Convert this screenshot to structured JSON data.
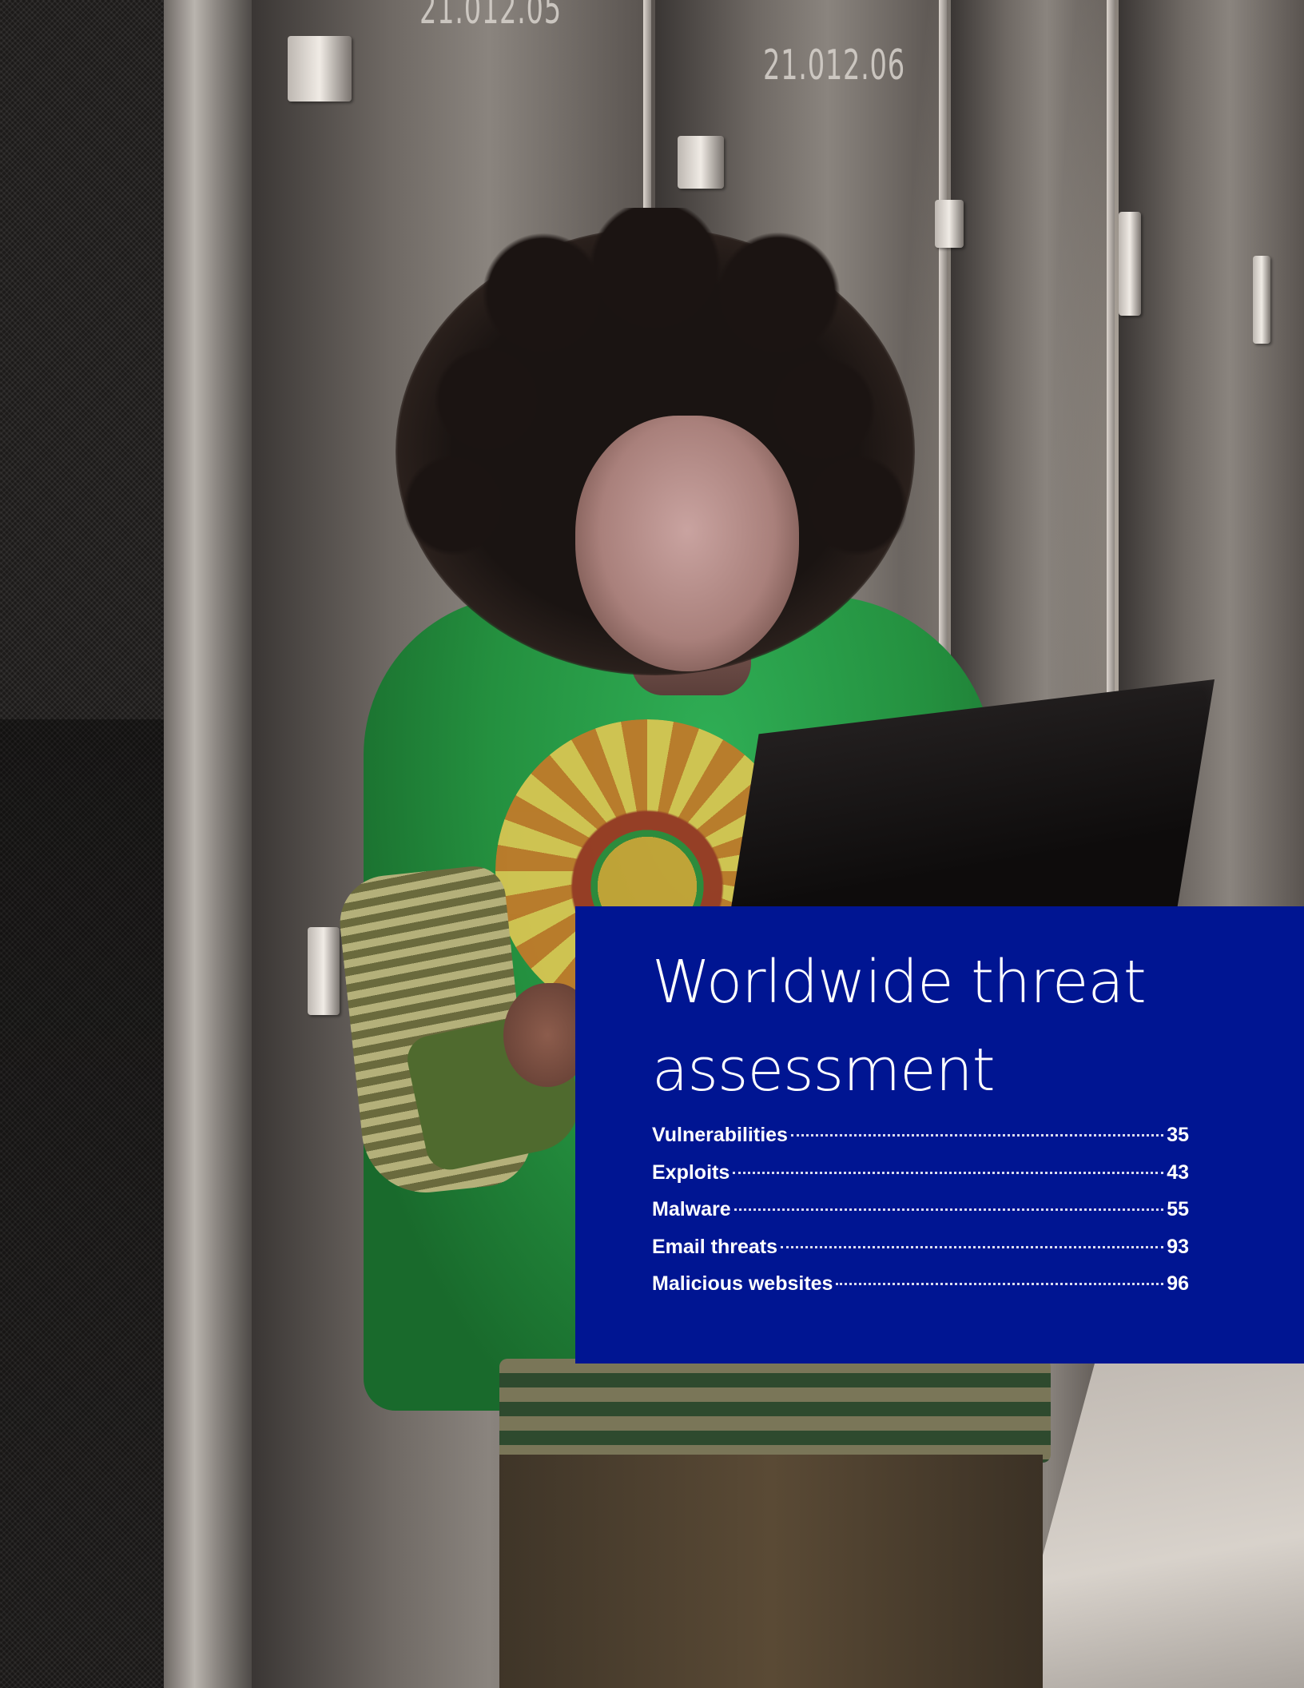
{
  "background_photo": {
    "rack_numbers": [
      "21.012.05",
      "21.012.06"
    ]
  },
  "panel": {
    "title": "Worldwide threat assessment",
    "background_color": "#001592",
    "text_color": "#ffffff"
  },
  "toc": [
    {
      "label": "Vulnerabilities",
      "page": "35"
    },
    {
      "label": "Exploits",
      "page": "43"
    },
    {
      "label": "Malware",
      "page": "55"
    },
    {
      "label": "Email threats",
      "page": "93"
    },
    {
      "label": "Malicious websites",
      "page": "96"
    }
  ]
}
